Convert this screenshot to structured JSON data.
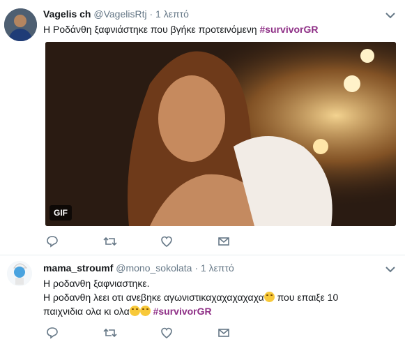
{
  "tweets": [
    {
      "name": "Vagelis ch",
      "handle": "@VagelisRtj",
      "time": "1 λεπτό",
      "text": "Η Ροδάνθη ξαφνιάστηκε που βγήκε προτεινόμενη ",
      "hashtag": "#survivorGR",
      "media_badge": "GIF"
    },
    {
      "name": "mama_stroumf",
      "handle": "@mono_sokolata",
      "time": "1 λεπτό",
      "line1": "Η ροδανθη ξαφνιαστηκε.",
      "line2_before": "Η ροδανθη λεει οτι ανεβηκε αγωνιστικαχαχαχαχαχα",
      "line2_after": " που επαιξε 10",
      "line3": "παιχνιδια ολα κι ολα",
      "hashtag": "#survivorGR"
    }
  ],
  "icons": [
    "reply-icon",
    "retweet-icon",
    "like-icon",
    "dm-icon",
    "chevron-down-icon"
  ],
  "colors": {
    "hashtag": "#8e2f86",
    "meta": "#657786",
    "icon": "#657786"
  },
  "separator": "·"
}
